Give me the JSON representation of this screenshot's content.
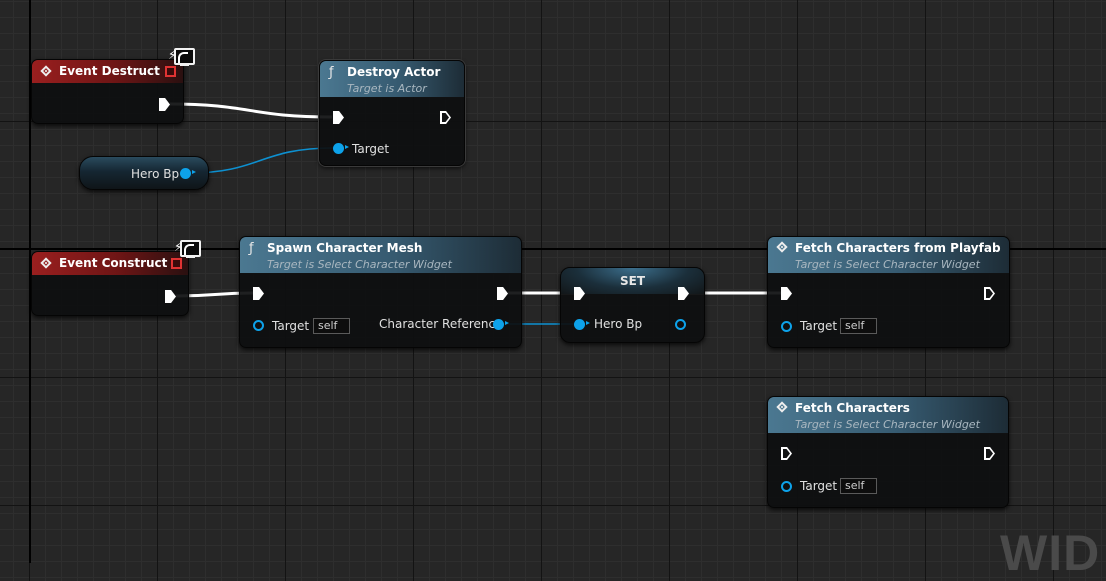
{
  "canvas": {
    "watermark": "WID"
  },
  "nodes": {
    "event_destruct": {
      "title": "Event Destruct"
    },
    "destroy_actor": {
      "title": "Destroy Actor",
      "subtitle": "Target is Actor",
      "target_label": "Target"
    },
    "hero_bp_var": {
      "label": "Hero Bp"
    },
    "event_construct": {
      "title": "Event Construct"
    },
    "spawn_character_mesh": {
      "title": "Spawn Character Mesh",
      "subtitle": "Target is Select Character Widget",
      "target_label": "Target",
      "target_value": "self",
      "output_label": "Character Reference"
    },
    "set_node": {
      "title": "SET",
      "input_label": "Hero Bp"
    },
    "fetch_characters_playfab": {
      "title": "Fetch Characters from Playfab",
      "subtitle": "Target is Select Character Widget",
      "target_label": "Target",
      "target_value": "self"
    },
    "fetch_characters": {
      "title": "Fetch Characters",
      "subtitle": "Target is Select Character Widget",
      "target_label": "Target",
      "target_value": "self"
    }
  },
  "icons": {
    "event": "event-diamond-icon",
    "function": "function-f-icon",
    "client": "client-monitor-icon",
    "delegate": "delegate-red-square-icon"
  },
  "colors": {
    "event_header": "#9a1f1f",
    "function_header": "#4b7891",
    "object_pin": "#0da2ea",
    "exec_wire": "#ffffff",
    "grid_background": "#262626"
  }
}
